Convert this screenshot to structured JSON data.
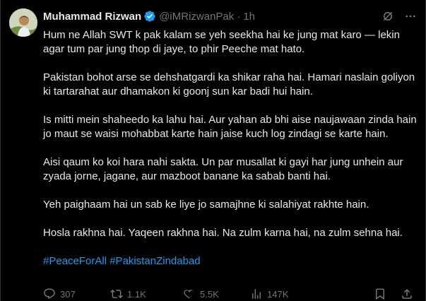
{
  "tweet": {
    "author": {
      "display_name": "Muhammad Rizwan",
      "handle": "@iMRizwanPak",
      "separator": "·",
      "time": "1h",
      "verified_color": "#1d9bf0"
    },
    "paragraphs": [
      "Hum ne Allah SWT k pak kalam se yeh seekha hai ke jung mat karo — lekin agar tum par jung thop di jaye, to phir Peeche mat hato.",
      "Pakistan bohot arse se dehshatgardi ka shikar raha hai. Hamari naslain goliyon ki tartarahat aur dhamakon ki goonj sun kar badi hui hain.",
      "Is mitti mein shaheedo ka lahu hai. Aur yahan ab bhi aise naujawaan zinda hain jo maut se waisi mohabbat karte hain jaise kuch log zindagi se karte hain.",
      "Aisi qaum ko koi hara nahi sakta. Un par musallat ki gayi har jung unhein aur zyada jorne, jagane, aur mazboot banane ka sabab banti hai.",
      "Yeh paighaam hai un sab ke liye jo samajhne ki salahiyat rakhte hain.",
      "Hosla rakhna hai. Yaqeen rakhna hai. Na zulm karna hai, na zulm sehna hai."
    ],
    "hashtags": [
      "#PeaceForAll",
      "#PakistanZindabad"
    ],
    "stats": {
      "replies": "307",
      "reposts": "1.1K",
      "likes": "5.5K",
      "views": "147K"
    },
    "icons": {
      "avatar": "profile-photo",
      "grok": "grok-icon",
      "more": "more-icon",
      "reply": "reply-icon",
      "repost": "repost-icon",
      "like": "heart-icon",
      "views": "views-chart-icon",
      "bookmark": "bookmark-icon",
      "share": "share-icon"
    },
    "colors": {
      "background": "#000000",
      "text": "#e7e9ea",
      "muted": "#71767b",
      "link": "#1d9bf0"
    }
  }
}
